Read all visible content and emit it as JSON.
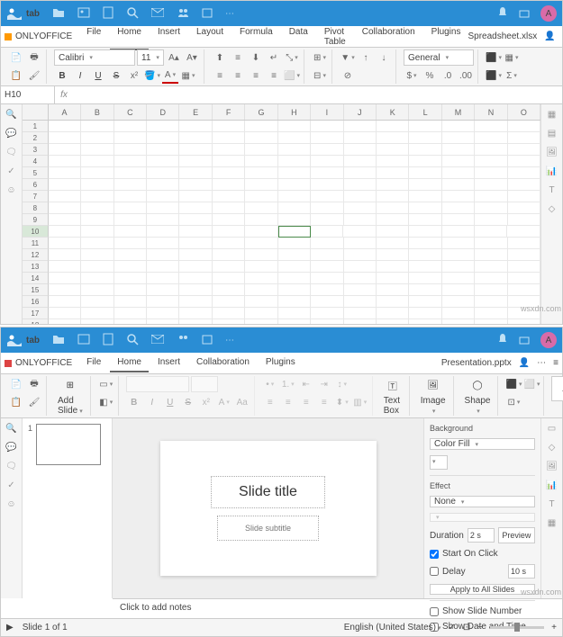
{
  "brand": "tab",
  "avatar_initial": "A",
  "spreadsheet": {
    "app_name": "ONLYOFFICE",
    "file_name": "Spreadsheet.xlsx",
    "menus": [
      "File",
      "Home",
      "Insert",
      "Layout",
      "Formula",
      "Data",
      "Pivot Table",
      "Collaboration",
      "Plugins"
    ],
    "active_menu": "Home",
    "font_name": "Calibri",
    "font_size": "11",
    "number_format": "General",
    "active_cell": "H10",
    "columns": [
      "A",
      "B",
      "C",
      "D",
      "E",
      "F",
      "G",
      "H",
      "I",
      "J",
      "K",
      "L",
      "M",
      "N",
      "O"
    ],
    "row_count": 21,
    "active_row": 10,
    "active_col": 8
  },
  "presentation": {
    "app_name": "ONLYOFFICE",
    "file_name": "Presentation.pptx",
    "menus": [
      "File",
      "Home",
      "Insert",
      "Collaboration",
      "Plugins"
    ],
    "active_menu": "Home",
    "add_slide_label": "Add Slide",
    "textbox_label": "Text Box",
    "image_label": "Image",
    "shape_label": "Shape",
    "aa_label": "Aa",
    "slide_title": "Slide title",
    "slide_subtitle": "Slide subtitle",
    "notes_placeholder": "Click to add notes",
    "props": {
      "background_label": "Background",
      "background_value": "Color Fill",
      "effect_label": "Effect",
      "effect_value": "None",
      "duration_label": "Duration",
      "duration_value": "2 s",
      "preview_label": "Preview",
      "start_on_click_label": "Start On Click",
      "start_on_click": true,
      "delay_label": "Delay",
      "delay_value": "10 s",
      "delay": false,
      "apply_all_label": "Apply to All Slides",
      "show_slide_number_label": "Show Slide Number",
      "show_slide_number": false,
      "show_date_label": "Show Date and Time",
      "show_date": false
    },
    "status": {
      "slide_info": "Slide 1 of 1",
      "language": "English (United States)"
    }
  },
  "watermark": "wsxdn.com"
}
